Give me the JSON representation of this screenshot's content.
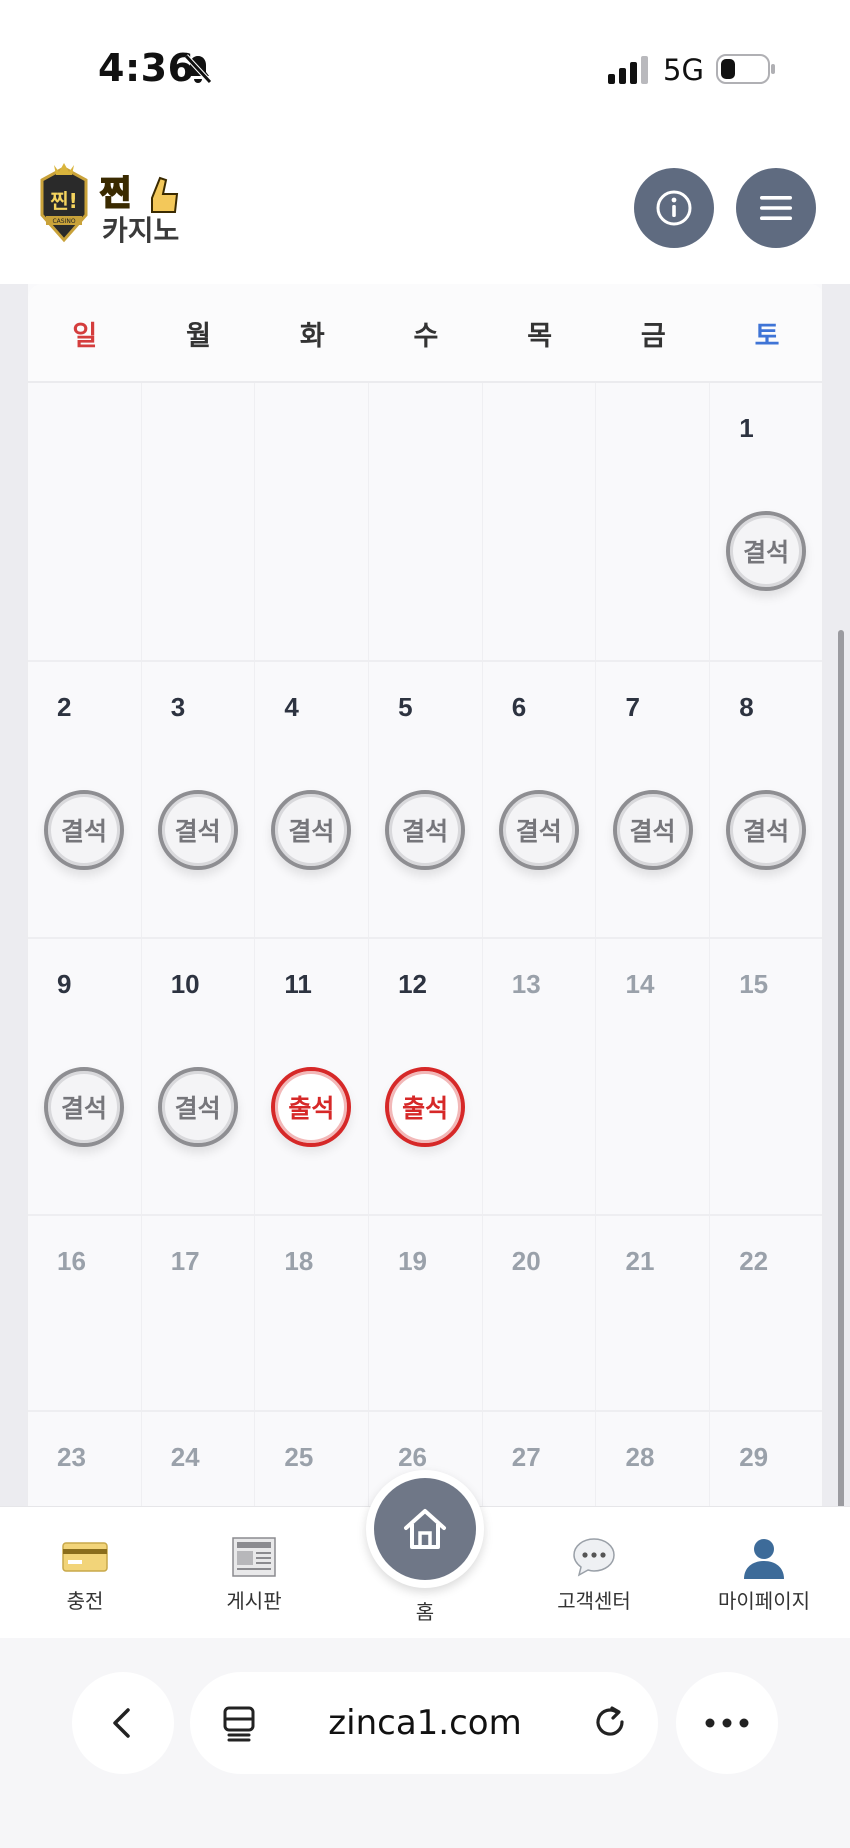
{
  "status_bar": {
    "time": "4:36",
    "network": "5G",
    "icons": [
      "bell-muted-icon",
      "signal-icon",
      "battery-icon"
    ]
  },
  "header": {
    "logo_text_top": "찐!",
    "logo_text_main": "찐",
    "logo_text_sub": "카지노",
    "logo_badge": "CASINO",
    "info_icon": "info-icon",
    "menu_icon": "hamburger-menu-icon"
  },
  "calendar": {
    "weekdays": [
      "일",
      "월",
      "화",
      "수",
      "목",
      "금",
      "토"
    ],
    "status_labels": {
      "absent": "결석",
      "present": "출석"
    },
    "weeks": [
      [
        {
          "day": "",
          "status": ""
        },
        {
          "day": "",
          "status": ""
        },
        {
          "day": "",
          "status": ""
        },
        {
          "day": "",
          "status": ""
        },
        {
          "day": "",
          "status": ""
        },
        {
          "day": "",
          "status": ""
        },
        {
          "day": "1",
          "status": "결석"
        }
      ],
      [
        {
          "day": "2",
          "status": "결석"
        },
        {
          "day": "3",
          "status": "결석"
        },
        {
          "day": "4",
          "status": "결석"
        },
        {
          "day": "5",
          "status": "결석"
        },
        {
          "day": "6",
          "status": "결석"
        },
        {
          "day": "7",
          "status": "결석"
        },
        {
          "day": "8",
          "status": "결석"
        }
      ],
      [
        {
          "day": "9",
          "status": "결석"
        },
        {
          "day": "10",
          "status": "결석"
        },
        {
          "day": "11",
          "status": "출석"
        },
        {
          "day": "12",
          "status": "출석"
        },
        {
          "day": "13",
          "status": ""
        },
        {
          "day": "14",
          "status": ""
        },
        {
          "day": "15",
          "status": ""
        }
      ],
      [
        {
          "day": "16",
          "status": ""
        },
        {
          "day": "17",
          "status": ""
        },
        {
          "day": "18",
          "status": ""
        },
        {
          "day": "19",
          "status": ""
        },
        {
          "day": "20",
          "status": ""
        },
        {
          "day": "21",
          "status": ""
        },
        {
          "day": "22",
          "status": ""
        }
      ],
      [
        {
          "day": "23",
          "status": ""
        },
        {
          "day": "24",
          "status": ""
        },
        {
          "day": "25",
          "status": ""
        },
        {
          "day": "26",
          "status": ""
        },
        {
          "day": "27",
          "status": ""
        },
        {
          "day": "28",
          "status": ""
        },
        {
          "day": "29",
          "status": ""
        }
      ]
    ],
    "last_attended_day": "12"
  },
  "bottom_nav": {
    "items": [
      {
        "label": "충전",
        "icon": "credit-card-icon"
      },
      {
        "label": "게시판",
        "icon": "newspaper-icon"
      },
      {
        "label": "홈",
        "icon": "home-icon"
      },
      {
        "label": "고객센터",
        "icon": "chat-bubble-icon"
      },
      {
        "label": "마이페이지",
        "icon": "user-icon"
      }
    ]
  },
  "browser": {
    "url": "zinca1.com",
    "icons": [
      "back-icon",
      "tabs-icon",
      "reload-icon",
      "more-icon"
    ]
  },
  "colors": {
    "sunday": "#d43d3d",
    "saturday": "#3f74d6",
    "present_stamp": "#d62828",
    "absent_stamp": "#8e8e92",
    "header_button": "#5f6b80"
  }
}
